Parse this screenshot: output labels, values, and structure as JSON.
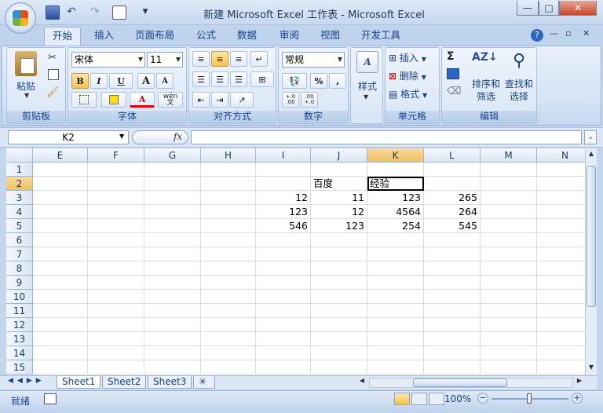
{
  "title": "新建 Microsoft Excel 工作表 - Microsoft Excel",
  "tabs": [
    "开始",
    "插入",
    "页面布局",
    "公式",
    "数据",
    "审阅",
    "视图",
    "开发工具"
  ],
  "ribbon": {
    "clipboard": {
      "label": "剪贴板",
      "paste": "粘贴"
    },
    "font": {
      "label": "字体",
      "name": "宋体",
      "size": "11",
      "bold": "B",
      "italic": "I",
      "underline": "U",
      "grow": "A",
      "shrink": "A",
      "color_a": "A",
      "wen": "wén\n文"
    },
    "alignment": {
      "label": "对齐方式"
    },
    "number": {
      "label": "数字",
      "format": "常规",
      "percent": "%",
      "comma": ",",
      "inc_decimal": "+.0\n.00",
      "dec_decimal": ".00\n+.0"
    },
    "styles": {
      "label": "样式"
    },
    "cells": {
      "label": "单元格",
      "insert": "插入",
      "delete": "删除",
      "format": "格式"
    },
    "editing": {
      "label": "编辑",
      "sort": "排序和\n筛选",
      "find": "查找和\n选择",
      "sigma": "Σ"
    }
  },
  "formula_bar": {
    "name_box": "K2",
    "fx": "fx",
    "value": ""
  },
  "columns": [
    "E",
    "F",
    "G",
    "H",
    "I",
    "J",
    "K",
    "L",
    "M",
    "N"
  ],
  "rows": [
    "1",
    "2",
    "3",
    "4",
    "5",
    "6",
    "7",
    "8",
    "9",
    "10",
    "11",
    "12",
    "13",
    "14",
    "15"
  ],
  "cells": {
    "J2": "百度",
    "K2": "经验",
    "I3": "12",
    "J3": "11",
    "K3": "123",
    "L3": "265",
    "I4": "123",
    "J4": "12",
    "K4": "4564",
    "L4": "264",
    "I5": "546",
    "J5": "123",
    "K5": "254",
    "L5": "545"
  },
  "sheets": [
    "Sheet1",
    "Sheet2",
    "Sheet3"
  ],
  "status": {
    "mode": "就绪",
    "zoom": "100%"
  },
  "colors": {
    "accent": "#15428b",
    "selected_header": "#f1c15f",
    "ribbon": "#d4e3f5"
  }
}
